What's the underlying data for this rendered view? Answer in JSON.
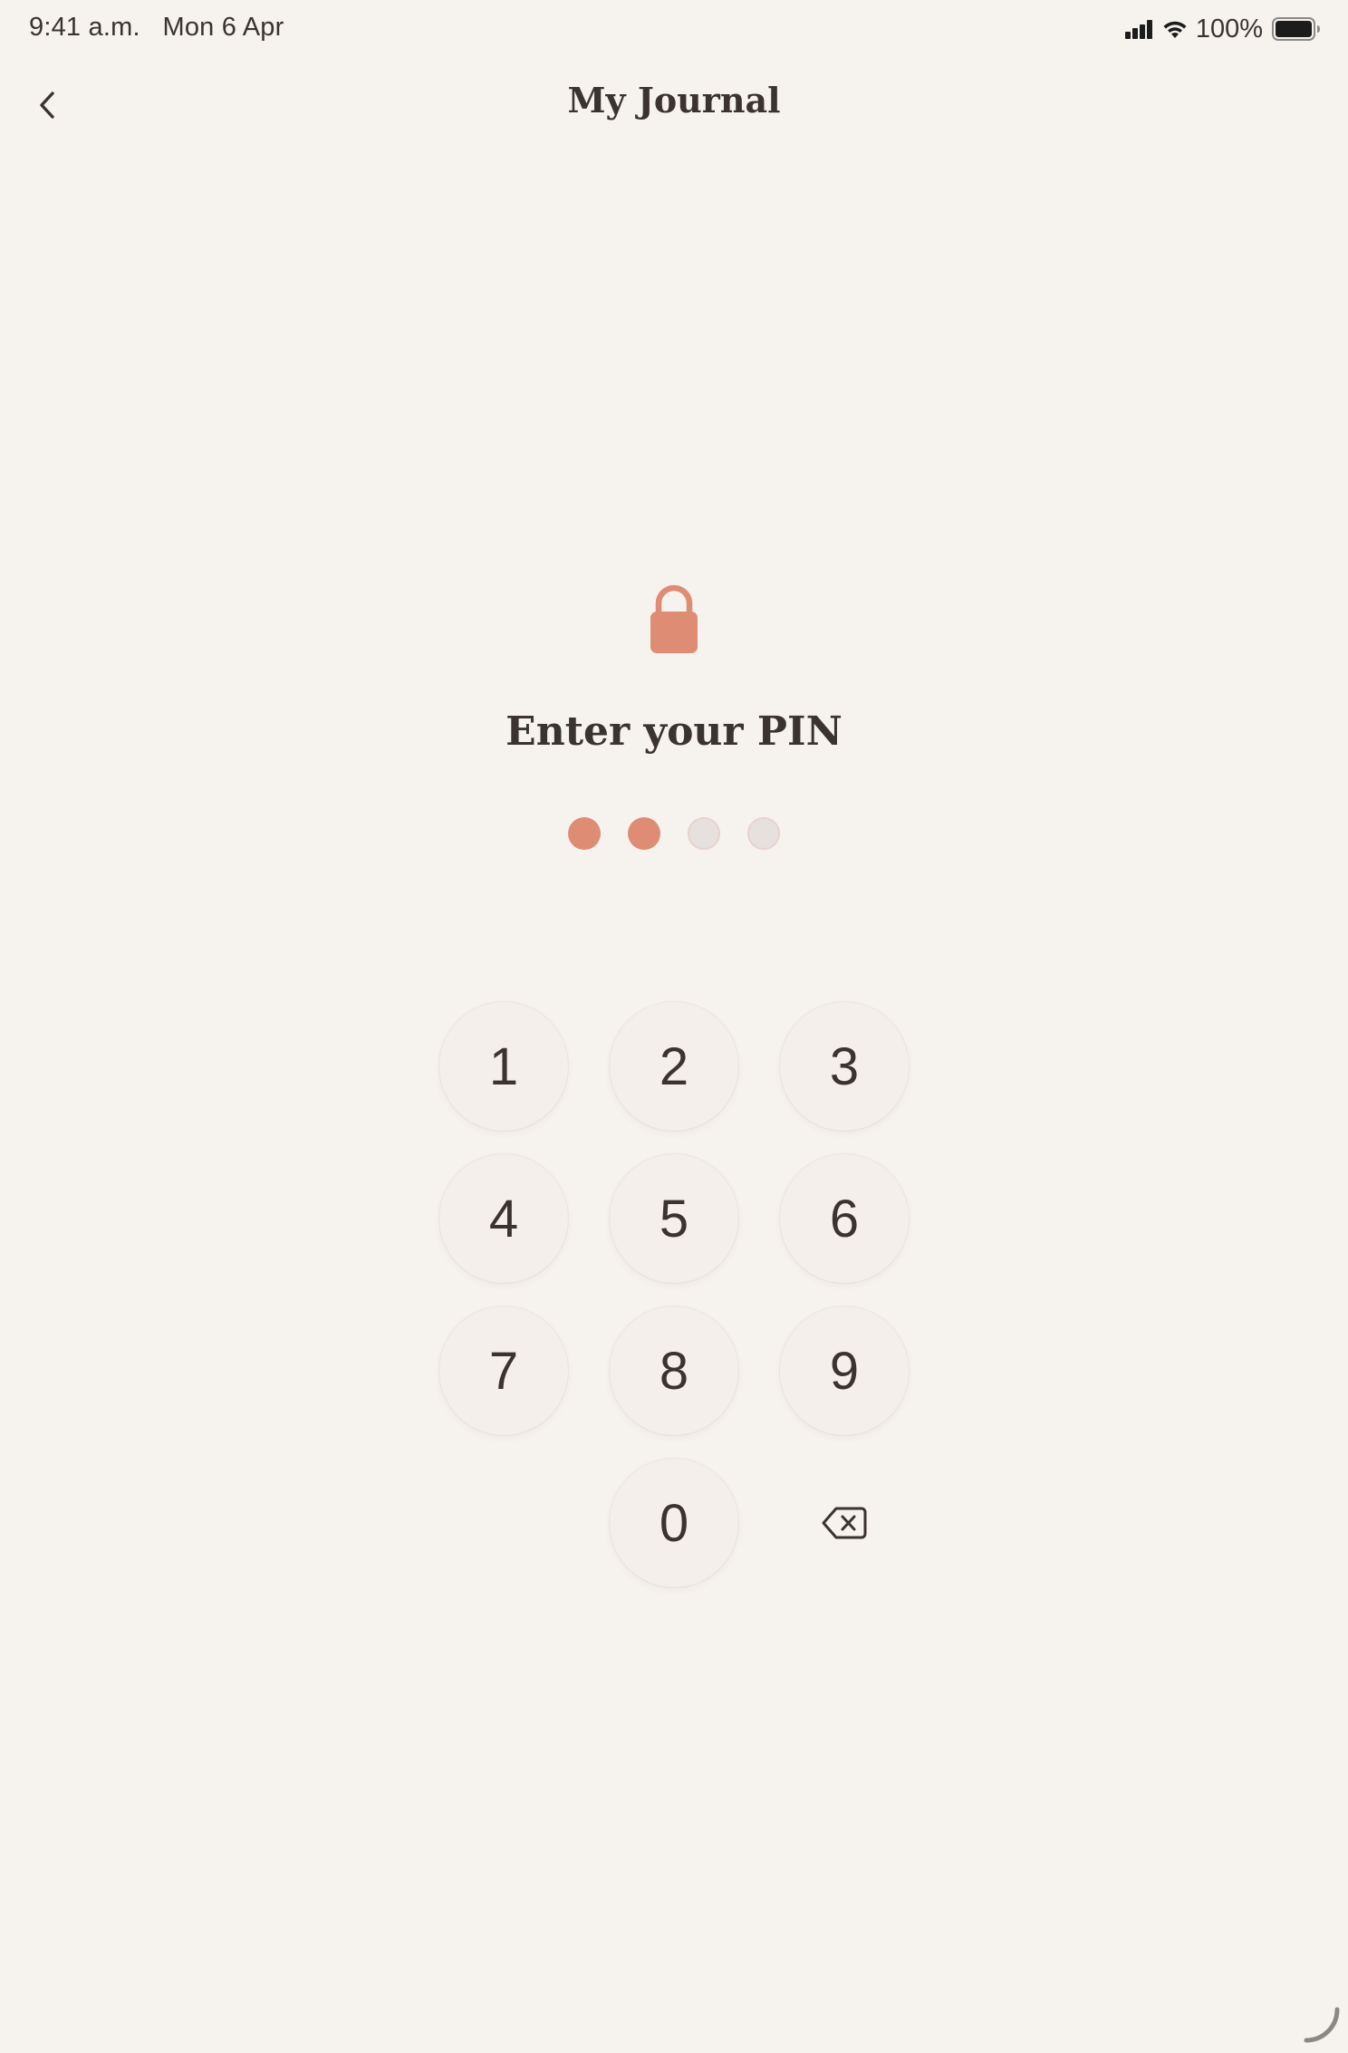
{
  "status_bar": {
    "time": "9:41 a.m.",
    "date": "Mon 6 Apr",
    "battery": "100%"
  },
  "nav": {
    "title": "My Journal",
    "back_icon": "chevron-left-icon"
  },
  "lock": {
    "icon": "lock-icon",
    "prompt": "Enter your PIN",
    "pin_length": 4,
    "digits_entered": 2
  },
  "keypad": {
    "keys": [
      "1",
      "2",
      "3",
      "4",
      "5",
      "6",
      "7",
      "8",
      "9",
      "0"
    ],
    "delete_icon": "backspace-icon"
  },
  "colors": {
    "background": "#f6f2ee",
    "accent": "#de8d74",
    "text": "#3a3330",
    "dot_empty": "#e6e1de"
  }
}
